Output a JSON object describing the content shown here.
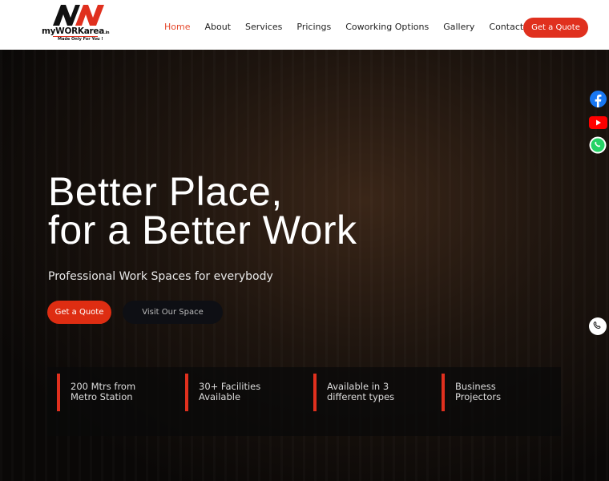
{
  "header": {
    "logo": {
      "name": "myWORKarea",
      "suffix": ".in",
      "tagline": "Made Only For You !"
    },
    "nav": [
      "Home",
      "About",
      "Services",
      "Pricings",
      "Coworking Options",
      "Gallery",
      "Contact"
    ],
    "active": "Home",
    "cta": "Get a Quote"
  },
  "hero": {
    "title_line1": "Better Place,",
    "title_line2": "for a Better Work",
    "subtitle": "Professional Work Spaces for everybody",
    "primary_button": "Get a Quote",
    "secondary_button": "Visit Our Space"
  },
  "features": [
    {
      "line1": "200 Mtrs from",
      "line2": "Metro Station"
    },
    {
      "line1": "30+ Facilities",
      "line2": "Available"
    },
    {
      "line1": "Available in 3",
      "line2": "different types"
    },
    {
      "line1": "Business",
      "line2": "Projectors"
    }
  ],
  "social": [
    "facebook-icon",
    "youtube-icon",
    "whatsapp-icon",
    "phone-icon"
  ],
  "colors": {
    "accent": "#e0301e",
    "nav_active": "#e64a2e"
  }
}
